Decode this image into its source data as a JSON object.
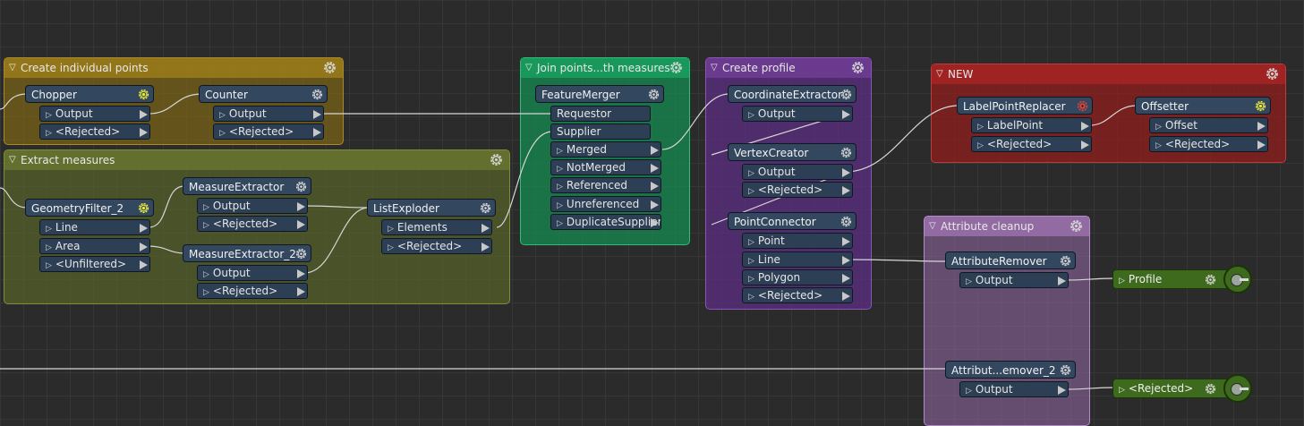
{
  "bookmarks": {
    "create_points": "Create individual points",
    "extract_measures": "Extract measures",
    "join_points": "Join points...th measures",
    "create_profile": "Create profile",
    "new": "NEW",
    "attribute_cleanup": "Attribute cleanup"
  },
  "transformers": {
    "chopper": "Chopper",
    "counter": "Counter",
    "geometry_filter": "GeometryFilter_2",
    "measure_extractor": "MeasureExtractor",
    "measure_extractor_2": "MeasureExtractor_2",
    "list_exploder": "ListExploder",
    "feature_merger": "FeatureMerger",
    "coordinate_extractor": "CoordinateExtractor",
    "vertex_creator": "VertexCreator",
    "point_connector": "PointConnector",
    "label_point_replacer": "LabelPointReplacer",
    "offsetter": "Offsetter",
    "attribute_remover": "AttributeRemover",
    "attribute_remover_2": "Attribut...emover_2"
  },
  "ports": {
    "output": "Output",
    "rejected": "<Rejected>",
    "line": "Line",
    "area": "Area",
    "unfiltered": "<Unfiltered>",
    "elements": "Elements",
    "requestor": "Requestor",
    "supplier": "Supplier",
    "merged": "Merged",
    "not_merged": "NotMerged",
    "referenced": "Referenced",
    "unreferenced": "Unreferenced",
    "duplicate_supplier": "DuplicateSupplier",
    "point": "Point",
    "polygon": "Polygon",
    "label_point": "LabelPoint",
    "offset": "Offset"
  },
  "writers": {
    "profile": "Profile",
    "rejected": "<Rejected>"
  },
  "colors": {
    "canvas": "#2b2b2b",
    "transformer": "#33475f",
    "writer": "#3e6a1e",
    "bookmark_yellow": "#a07f19",
    "bookmark_olive": "#6e7a30",
    "bookmark_green": "#19a05f",
    "bookmark_purple": "#6c3c91",
    "bookmark_red": "#a52323",
    "bookmark_lilac": "#a578b9"
  }
}
